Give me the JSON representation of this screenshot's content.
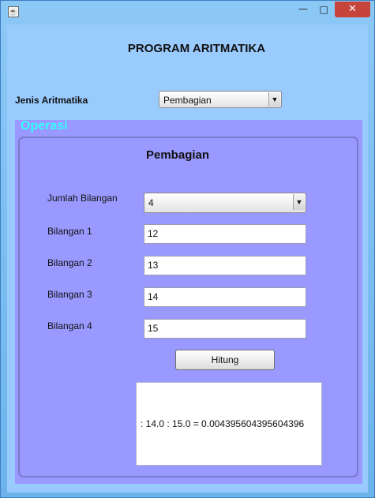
{
  "window": {
    "icon": "java-icon",
    "minimize_glyph": "—",
    "maximize_glyph": "□",
    "close_glyph": "✕"
  },
  "main": {
    "title": "PROGRAM ARITMATIKA",
    "jenis_label": "Jenis Aritmatika",
    "jenis_selected": "Pembagian"
  },
  "operasi": {
    "panel_title": "Operasi",
    "heading": "Pembagian",
    "jumlah_label": "Jumlah Bilangan",
    "jumlah_selected": "4",
    "fields": [
      {
        "label": "Bilangan 1",
        "value": "12"
      },
      {
        "label": "Bilangan 2",
        "value": "13"
      },
      {
        "label": "Bilangan 3",
        "value": "14"
      },
      {
        "label": "Bilangan 4",
        "value": "15"
      }
    ],
    "button_label": "Hitung",
    "result": ": 14.0 : 15.0 = 0.004395604395604396"
  },
  "colors": {
    "window_frame": "#6fb6f0",
    "content_bg": "#99cbff",
    "panel_bg": "#9999ff",
    "panel_title": "#33ffff",
    "close_button": "#c7443b"
  }
}
